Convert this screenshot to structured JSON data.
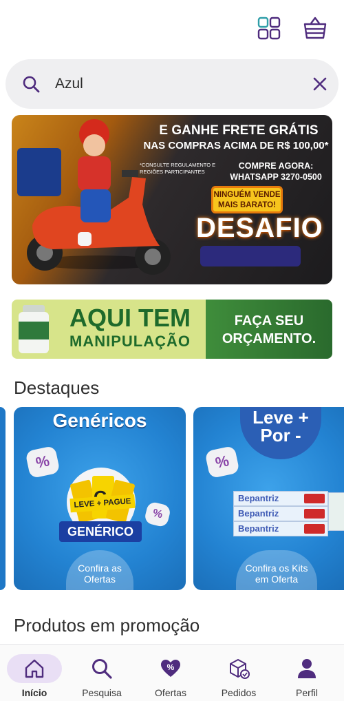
{
  "header": {
    "grid_icon": "grid-icon",
    "cart_icon": "basket-icon"
  },
  "search": {
    "value": "Azul",
    "placeholder": "",
    "search_icon": "search-icon",
    "clear_icon": "close-icon"
  },
  "banner": {
    "line1": "E GANHE FRETE GRÁTIS",
    "line2": "NAS COMPRAS ACIMA DE R$ 100,00*",
    "note": "*CONSULTE REGULAMENTO E REGIÕES PARTICIPANTES",
    "cta_line1": "COMPRE AGORA:",
    "cta_line2": "WHATSAPP 3270-0500",
    "badge_line1": "NINGUÉM VENDE",
    "badge_line2": "MAIS BARATO!",
    "challenge": "DESAFIO"
  },
  "manipulation_banner": {
    "title_line1": "AQUI TEM",
    "title_line2": "MANIPULAÇÃO",
    "cta_line1": "FAÇA SEU",
    "cta_line2": "ORÇAMENTO."
  },
  "highlights": {
    "title": "Destaques",
    "cards": [
      {
        "title": "Genéricos",
        "logo_line1": "LEVE + PAGUE",
        "logo_line2": "GENÉRICO",
        "cta_line1": "Confira as",
        "cta_line2": "Ofertas",
        "badge_symbol": "%"
      },
      {
        "title_line1": "Leve +",
        "title_line2": "Por -",
        "product_name": "Bepantriz",
        "cta_line1": "Confira os Kits",
        "cta_line2": "em Oferta",
        "badge_symbol": "%"
      }
    ]
  },
  "promotions": {
    "title": "Produtos em promoção"
  },
  "bottom_nav": {
    "items": [
      {
        "label": "Início",
        "icon": "home-icon",
        "active": true
      },
      {
        "label": "Pesquisa",
        "icon": "search-icon",
        "active": false
      },
      {
        "label": "Ofertas",
        "icon": "heart-percent-icon",
        "active": false
      },
      {
        "label": "Pedidos",
        "icon": "package-icon",
        "active": false
      },
      {
        "label": "Perfil",
        "icon": "person-icon",
        "active": false
      }
    ]
  },
  "colors": {
    "accent": "#4f2c7e",
    "nav_active_bg": "#e9dff5",
    "search_bg": "#efeff1",
    "card_blue": "#2383d2",
    "manip_green": "#1e6a2b"
  }
}
